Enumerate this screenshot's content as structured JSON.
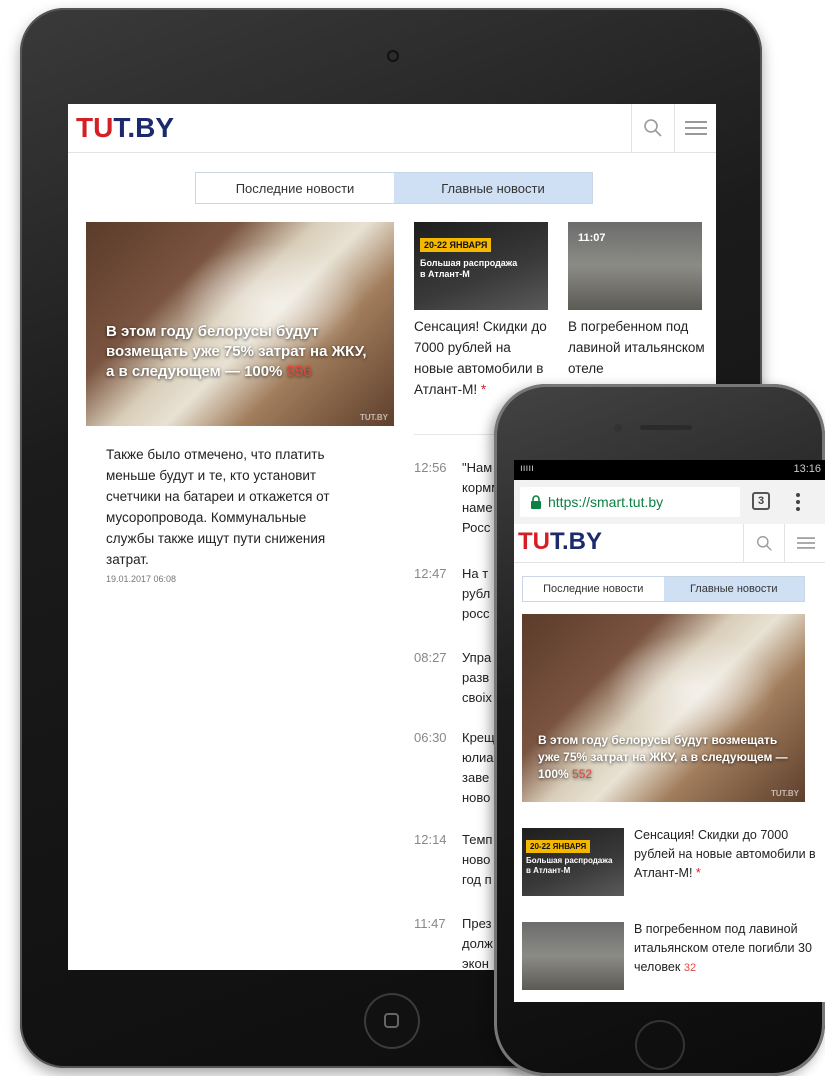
{
  "colors": {
    "brand_blue": "#1a2a6c",
    "brand_red": "#d32027",
    "tab_active": "#cfe0f5",
    "count_red": "#e4473f",
    "promo_yellow": "#f5b800"
  },
  "site": {
    "logo_t1": "T",
    "logo_u": "U",
    "logo_rest": "T.BY"
  },
  "tabs": [
    "Последние новости",
    "Главные новости"
  ],
  "icons": {
    "search": "search-icon",
    "menu": "menu-icon",
    "lock": "lock-icon",
    "more": "more-vert-icon"
  },
  "tablet": {
    "main_story": {
      "title": "В этом году белорусы будут возмещать уже 75% затрат на ЖКУ, а в следующем — 100%",
      "count": "556",
      "watermark": "TUT.BY"
    },
    "promo_card": {
      "tag": "20-22 ЯНВАРЯ",
      "promo_line1": "Большая распродажа",
      "promo_line2": "в Атлант-М",
      "title": "Сенсация! Скидки до 7000 рублей на новые автомобили в Атлант-М!",
      "star": "*"
    },
    "avalanche_card": {
      "time": "11:07",
      "title": "В погребенном под лавиной итальянском отеле"
    },
    "lead_text": "Также было отмечено, что платить меньше будут и те, кто установит счетчики на батареи и откажется от мусоропровода. Коммунальные службы также ищут пути снижения затрат.",
    "lead_date": "19.01.2017 06:08",
    "feed": [
      {
        "time": "12:56",
        "text": "\"Нам кормм наме Росс"
      },
      {
        "time": "12:47",
        "text": "На т рубл росс"
      },
      {
        "time": "08:27",
        "text": "Упра разв своіх"
      },
      {
        "time": "06:30",
        "text": "Крещ юлиа заве ново"
      },
      {
        "time": "12:14",
        "text": "Темп ново год п"
      },
      {
        "time": "11:47",
        "text": "През долж экон"
      }
    ]
  },
  "phone": {
    "status_left": "ııııı",
    "status_right": "13:16",
    "url": "https://smart.tut.by",
    "tab_count": "3",
    "main_story": {
      "title": "В этом году белорусы будут возмещать уже 75% затрат на ЖКУ, а в следующем — 100%",
      "count": "552",
      "watermark": "TUT.BY"
    },
    "promo_card": {
      "tag": "20-22 ЯНВАРЯ",
      "promo_line1": "Большая распродажа",
      "promo_line2": "в Атлант-М",
      "title": "Сенсация! Скидки до 7000 рублей на новые автомобили в Атлант-М!",
      "star": "*"
    },
    "avalanche_card": {
      "title": "В погребенном под лавиной итальянском отеле погибли 30 человек",
      "count": "32"
    }
  }
}
